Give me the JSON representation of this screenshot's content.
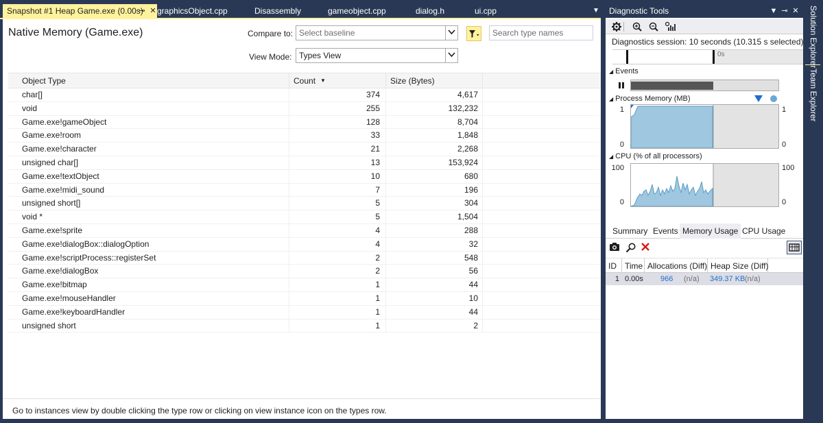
{
  "document_tabs": [
    {
      "label": "Snapshot #1 Heap Game.exe (0.00s)",
      "active": true
    },
    {
      "label": "graphicsObject.cpp"
    },
    {
      "label": "Disassembly"
    },
    {
      "label": "gameobject.cpp"
    },
    {
      "label": "dialog.h"
    },
    {
      "label": "ui.cpp"
    }
  ],
  "snapshot": {
    "title": "Native Memory (Game.exe)",
    "compare_label": "Compare to:",
    "compare_placeholder": "Select baseline",
    "view_mode_label": "View Mode:",
    "view_mode_value": "Types View",
    "search_placeholder": "Search type names",
    "columns": [
      "Object Type",
      "Count",
      "Size (Bytes)"
    ],
    "sorted_column": "Count",
    "rows": [
      {
        "type": "char[]",
        "count": "374",
        "size": "4,617"
      },
      {
        "type": "void",
        "count": "255",
        "size": "132,232"
      },
      {
        "type": "Game.exe!gameObject",
        "count": "128",
        "size": "8,704"
      },
      {
        "type": "Game.exe!room",
        "count": "33",
        "size": "1,848"
      },
      {
        "type": "Game.exe!character",
        "count": "21",
        "size": "2,268"
      },
      {
        "type": "unsigned char[]",
        "count": "13",
        "size": "153,924"
      },
      {
        "type": "Game.exe!textObject",
        "count": "10",
        "size": "680"
      },
      {
        "type": "Game.exe!midi_sound",
        "count": "7",
        "size": "196"
      },
      {
        "type": "unsigned short[]",
        "count": "5",
        "size": "304"
      },
      {
        "type": "void *",
        "count": "5",
        "size": "1,504"
      },
      {
        "type": "Game.exe!sprite",
        "count": "4",
        "size": "288"
      },
      {
        "type": "Game.exe!dialogBox::dialogOption",
        "count": "4",
        "size": "32"
      },
      {
        "type": "Game.exe!scriptProcess::registerSet",
        "count": "2",
        "size": "548"
      },
      {
        "type": "Game.exe!dialogBox",
        "count": "2",
        "size": "56"
      },
      {
        "type": "Game.exe!bitmap",
        "count": "1",
        "size": "44"
      },
      {
        "type": "Game.exe!mouseHandler",
        "count": "1",
        "size": "10"
      },
      {
        "type": "Game.exe!keyboardHandler",
        "count": "1",
        "size": "44"
      },
      {
        "type": "unsigned short",
        "count": "1",
        "size": "2"
      }
    ],
    "footer_hint": "Go to instances view by double clicking the type row or clicking on view instance icon on the types row."
  },
  "diagnostic_tools": {
    "title": "Diagnostic Tools",
    "toolbar_icons": [
      "settings-icon",
      "zoom-in-icon",
      "zoom-out-icon",
      "reset-view-icon"
    ],
    "session_text": "Diagnostics session: 10 seconds (10.315 s selected)",
    "timeline_label": "0s",
    "events_label": "Events",
    "process_memory_label": "Process Memory (MB)",
    "memory_axis_max": "1",
    "memory_axis_min": "0",
    "cpu_label": "CPU (% of all processors)",
    "cpu_axis_max": "100",
    "cpu_axis_min": "0",
    "tabs": [
      "Summary",
      "Events",
      "Memory Usage",
      "CPU Usage"
    ],
    "active_tab": "Memory Usage",
    "memory_columns": [
      "ID",
      "Time",
      "Allocations (Diff)",
      "Heap Size (Diff)"
    ],
    "memory_rows": [
      {
        "id": "1",
        "time": "0.00s",
        "allocations": "966",
        "allocations_diff": "(n/a)",
        "heap_size": "349.37 KB",
        "heap_diff": "(n/a)"
      }
    ],
    "colors": {
      "chart_fill": "#9fc7df",
      "chart_stroke": "#5b9bc8",
      "link": "#1e6fcc",
      "accent": "#fff29d"
    }
  },
  "side_tabs": [
    "Solution Explorer",
    "Team Explorer"
  ]
}
